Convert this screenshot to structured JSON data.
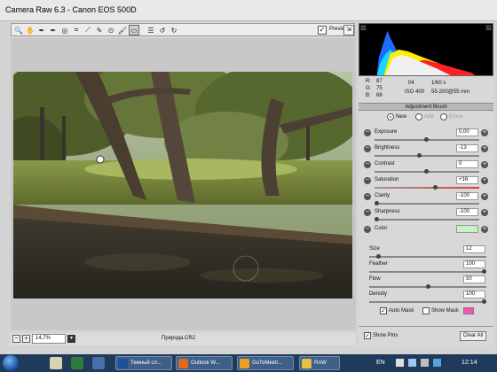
{
  "window": {
    "title": "Camera Raw 6.3  -  Canon EOS 500D"
  },
  "toolbar": {
    "tools": [
      {
        "name": "zoom-tool-icon",
        "glyph": "🔍"
      },
      {
        "name": "hand-tool-icon",
        "glyph": "✋"
      },
      {
        "name": "white-balance-tool-icon",
        "glyph": "✒"
      },
      {
        "name": "color-sampler-tool-icon",
        "glyph": "✒"
      },
      {
        "name": "target-adjustment-tool-icon",
        "glyph": "◎"
      },
      {
        "name": "crop-tool-icon",
        "glyph": "⌗"
      },
      {
        "name": "straighten-tool-icon",
        "glyph": "⟋"
      },
      {
        "name": "spot-removal-tool-icon",
        "glyph": "✎"
      },
      {
        "name": "red-eye-tool-icon",
        "glyph": "⊙"
      },
      {
        "name": "adjustment-brush-tool-icon",
        "glyph": "🖌"
      },
      {
        "name": "graduated-filter-tool-icon",
        "glyph": "▭"
      },
      {
        "name": "preferences-icon",
        "glyph": "☰"
      },
      {
        "name": "rotate-left-icon",
        "glyph": "↺"
      },
      {
        "name": "rotate-right-icon",
        "glyph": "↻"
      }
    ],
    "preview_label": "Preview",
    "preview_checked": "✓",
    "fullscreen_glyph": "⇲"
  },
  "status": {
    "zoom": "14,7%",
    "filename": "Природа.CR2",
    "zoom_out": "−",
    "zoom_in": "+"
  },
  "readout": {
    "r": "R:",
    "r_val": "87",
    "g": "G:",
    "g_val": "75",
    "b": "B:",
    "b_val": "68",
    "aperture": "f/4",
    "shutter": "1/60 s",
    "iso": "ISO 400",
    "lens": "55-200@55 mm"
  },
  "panel": {
    "title": "Adjustment Brush",
    "modes": [
      "New",
      "Add",
      "Erase"
    ],
    "sliders": [
      {
        "label": "Exposure",
        "value": "0,00"
      },
      {
        "label": "Brightness",
        "value": "-13"
      },
      {
        "label": "Contrast",
        "value": "0"
      },
      {
        "label": "Saturation",
        "value": "+16"
      },
      {
        "label": "Clarity",
        "value": "-100"
      },
      {
        "label": "Sharpness",
        "value": "-100"
      }
    ],
    "color_label": "Color",
    "color_swatch": "#c7f2c3",
    "brush": [
      {
        "label": "Size",
        "value": "12"
      },
      {
        "label": "Feather",
        "value": "100"
      },
      {
        "label": "Flow",
        "value": "50"
      },
      {
        "label": "Density",
        "value": "100"
      }
    ],
    "auto_mask": "Auto Mask",
    "show_mask": "Show Mask",
    "mask_color": "#ff4fb8",
    "show_pins": "Show Pins",
    "clear_all": "Clear All",
    "check": "✓"
  },
  "taskbar": {
    "tasks": [
      {
        "label": "Темный сл...",
        "color": "#1d4f9e"
      },
      {
        "label": "Outlook W...",
        "color": "#e06a1a"
      },
      {
        "label": "GoToMeeti...",
        "color": "#f0a020"
      },
      {
        "label": "RAW",
        "color": "#e8c040"
      }
    ],
    "lang": "EN",
    "clock": "12:14"
  }
}
